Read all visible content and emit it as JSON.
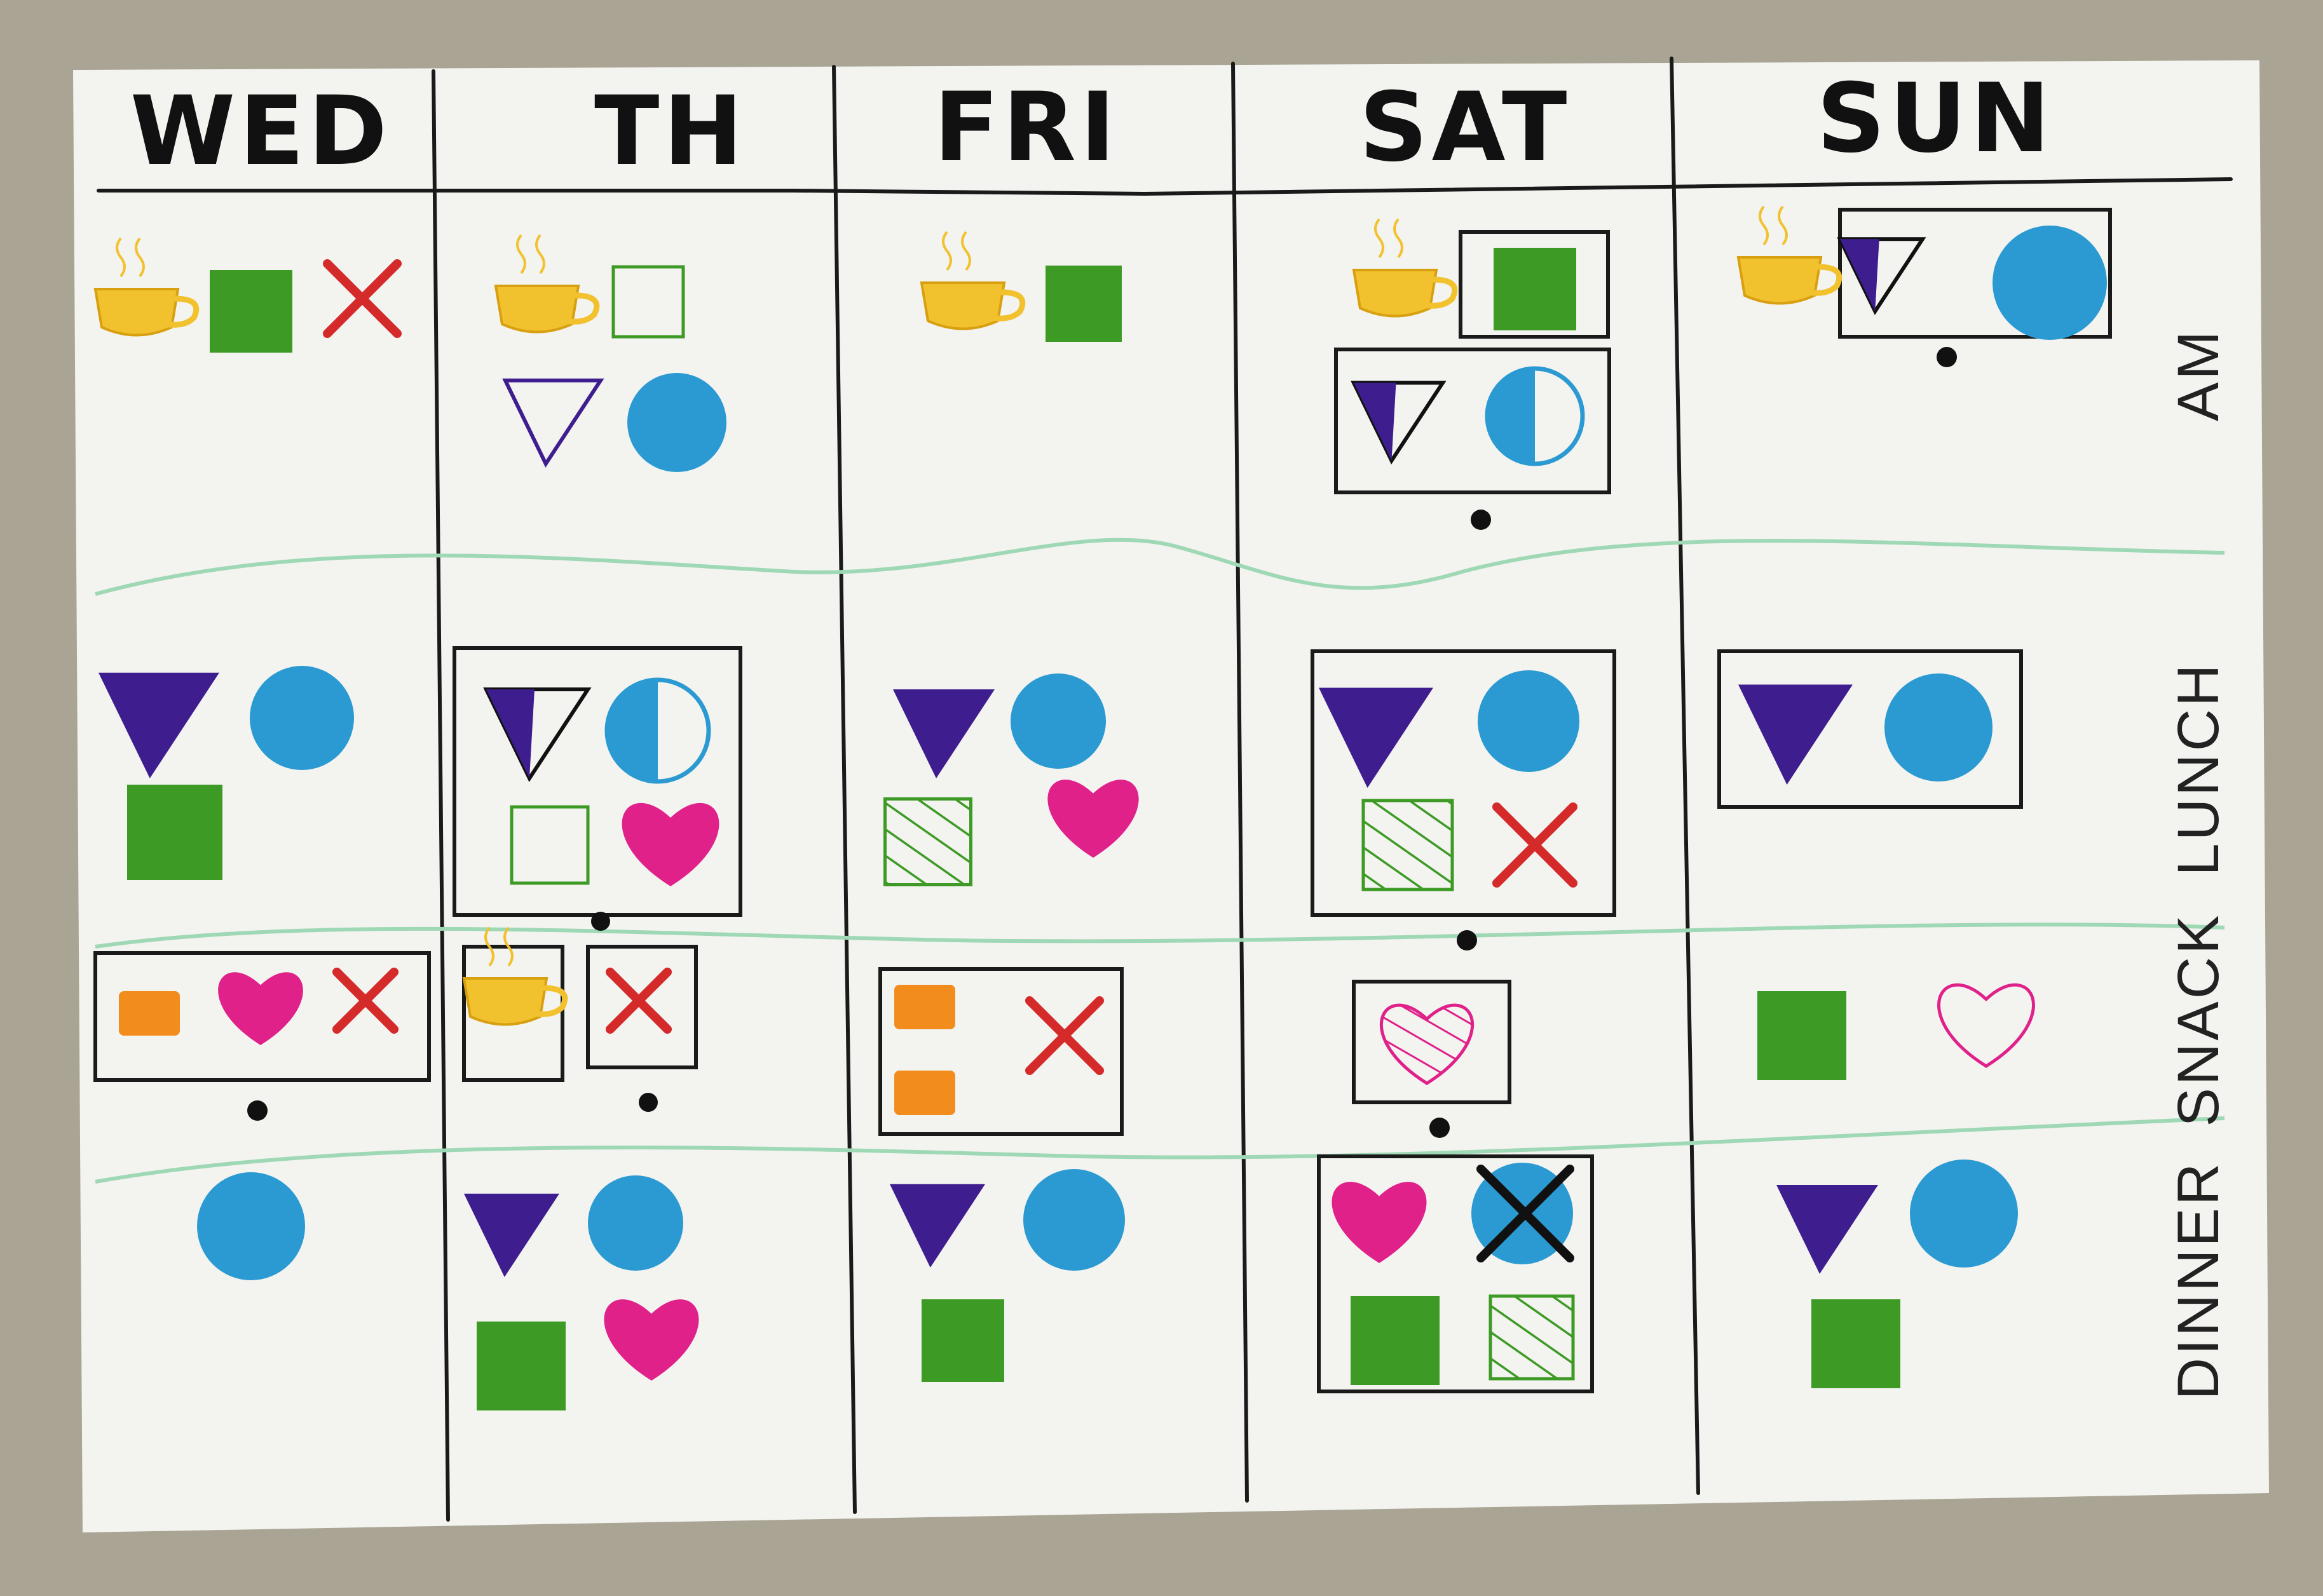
{
  "days": [
    "WED",
    "TH",
    "FRI",
    "SAT",
    "SUN"
  ],
  "meals": [
    "AM",
    "LUNCH",
    "SNACK",
    "DINNER"
  ],
  "colors": {
    "board": "#f3f3f0",
    "background": "#a9a493",
    "ink": "#1a1a1a",
    "meal_divider": "#9fd8b4",
    "cup": "#f2c12e",
    "green": "#3d9a24",
    "red": "#d42a2a",
    "purple": "#3e1d8f",
    "blue": "#2b9ad2",
    "pink": "#e0218a",
    "orange": "#f28c1c"
  }
}
